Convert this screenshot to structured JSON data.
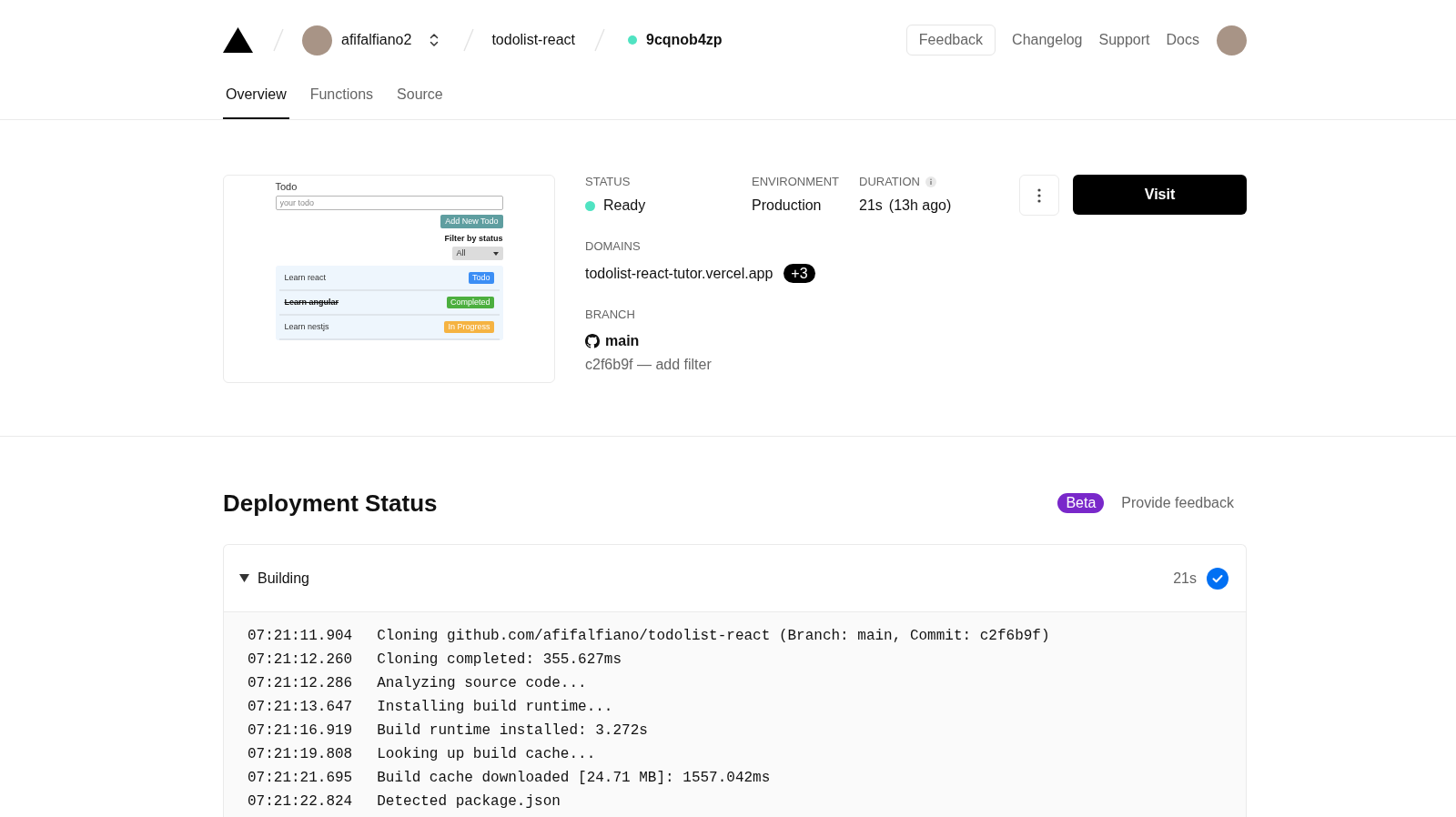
{
  "header": {
    "team": {
      "name": "afifalfiano2"
    },
    "project": "todolist-react",
    "deployment": {
      "id": "9cqnob4zp",
      "color": "#50e3c2"
    },
    "links": [
      {
        "label": "Feedback",
        "kind": "button"
      },
      {
        "label": "Changelog",
        "kind": "link"
      },
      {
        "label": "Support",
        "kind": "link"
      },
      {
        "label": "Docs",
        "kind": "link"
      }
    ]
  },
  "tabs": [
    {
      "label": "Overview",
      "selected": true
    },
    {
      "label": "Functions",
      "selected": false
    },
    {
      "label": "Source",
      "selected": false
    }
  ],
  "preview": {
    "title": "Todo",
    "input": {
      "placeholder": "your todo"
    },
    "add_button": "Add New Todo",
    "filter_label": "Filter by status",
    "filter_value": "All",
    "todos": [
      {
        "text": "Learn react",
        "status": "Todo",
        "color": "#3b8ef5",
        "done": false
      },
      {
        "text": "Learn angular",
        "status": "Completed",
        "color": "#4caf3f",
        "done": true
      },
      {
        "text": "Learn nestjs",
        "status": "In Progress",
        "color": "#f5b342",
        "done": false
      }
    ]
  },
  "details": {
    "status": {
      "label": "STATUS",
      "value": "Ready",
      "color": "#50e3c2"
    },
    "environment": {
      "label": "ENVIRONMENT",
      "value": "Production"
    },
    "duration": {
      "label": "DURATION",
      "value": "21s",
      "ago": "(13h ago)"
    },
    "domains": {
      "label": "DOMAINS",
      "primary": "todolist-react-tutor.vercel.app",
      "more": "+3"
    },
    "branch": {
      "label": "BRANCH",
      "name": "main",
      "commit": "c2f6b9f — add filter"
    },
    "visit_button": "Visit"
  },
  "deployment_status": {
    "title": "Deployment Status",
    "badge": "Beta",
    "feedback_link": "Provide feedback",
    "steps": [
      {
        "label": "Building",
        "expanded": true,
        "duration": "21s",
        "done": true,
        "logs": [
          {
            "time": "07:21:11.904",
            "message": "Cloning github.com/afifalfiano/todolist-react (Branch: main, Commit: c2f6b9f)"
          },
          {
            "time": "07:21:12.260",
            "message": "Cloning completed: 355.627ms"
          },
          {
            "time": "07:21:12.286",
            "message": "Analyzing source code..."
          },
          {
            "time": "07:21:13.647",
            "message": "Installing build runtime..."
          },
          {
            "time": "07:21:16.919",
            "message": "Build runtime installed: 3.272s"
          },
          {
            "time": "07:21:19.808",
            "message": "Looking up build cache..."
          },
          {
            "time": "07:21:21.695",
            "message": "Build cache downloaded [24.71 MB]: 1557.042ms"
          },
          {
            "time": "07:21:22.824",
            "message": "Detected package.json"
          }
        ]
      }
    ]
  }
}
